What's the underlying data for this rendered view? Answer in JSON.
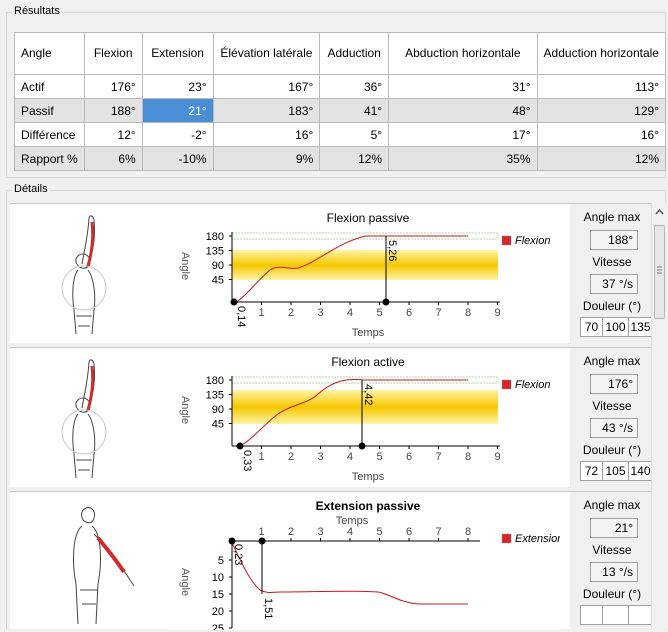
{
  "results": {
    "title": "Résultats",
    "headers": [
      "Angle",
      "Flexion",
      "Extension",
      "Élévation latérale",
      "Adduction",
      "Abduction horizontale",
      "Adduction horizontale"
    ],
    "rows": [
      {
        "label": "Actif",
        "values": [
          "176°",
          "23°",
          "167°",
          "36°",
          "31°",
          "113°"
        ]
      },
      {
        "label": "Passif",
        "values": [
          "188°",
          "21°",
          "183°",
          "41°",
          "48°",
          "129°"
        ]
      },
      {
        "label": "Différence",
        "values": [
          "12°",
          "-2°",
          "16°",
          "5°",
          "17°",
          "16°"
        ]
      },
      {
        "label": "Rapport %",
        "values": [
          "6%",
          "-10%",
          "9%",
          "12%",
          "35%",
          "12%"
        ]
      }
    ]
  },
  "details": {
    "title": "Détails",
    "side_labels": {
      "angle_max": "Angle max",
      "vitesse": "Vitesse",
      "douleur": "Douleur (°)"
    },
    "panels": [
      {
        "chart_title": "Flexion passive",
        "legend": "Flexion",
        "x_label": "Temps",
        "y_label": "Angle",
        "yticks": [
          "180",
          "135",
          "90",
          "45"
        ],
        "xticks": [
          "1",
          "2",
          "3",
          "4",
          "5",
          "6",
          "7",
          "8",
          "9"
        ],
        "marker_start": "0,14",
        "marker_end": "5,26",
        "angle_max": "188°",
        "vitesse": "37 °/s",
        "douleur": [
          "70",
          "100",
          "135"
        ]
      },
      {
        "chart_title": "Flexion active",
        "legend": "Flexion",
        "x_label": "Temps",
        "y_label": "Angle",
        "yticks": [
          "180",
          "135",
          "90",
          "45"
        ],
        "xticks": [
          "1",
          "2",
          "3",
          "4",
          "5",
          "6",
          "7",
          "8",
          "9"
        ],
        "marker_start": "0,33",
        "marker_end": "4,42",
        "angle_max": "176°",
        "vitesse": "43 °/s",
        "douleur": [
          "72",
          "105",
          "140"
        ]
      },
      {
        "chart_title": "Extension passive",
        "legend": "Extension",
        "x_label": "Temps",
        "y_label": "Angle",
        "yticks": [
          "5",
          "10",
          "15",
          "20",
          "25"
        ],
        "xticks": [
          "1",
          "2",
          "3",
          "4",
          "5",
          "6",
          "7",
          "8"
        ],
        "marker_start": "0,23",
        "marker_end": "1,51",
        "angle_max": "21°",
        "vitesse": "13 °/s",
        "douleur": [
          "",
          "",
          ""
        ]
      }
    ]
  },
  "colors": {
    "selection": "#4a8fd6",
    "curve": "#c8181e",
    "band_center": "#f6c800",
    "band_edge": "#fff3a8",
    "legend_swatch": "#d8242a",
    "hatch": "#5fb84a"
  }
}
